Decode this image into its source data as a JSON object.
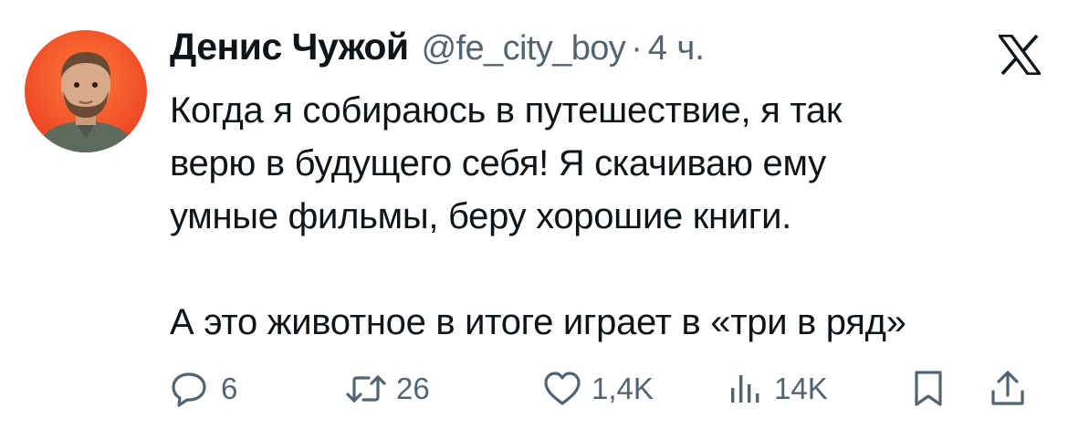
{
  "author": {
    "display_name": "Денис Чужой",
    "handle": "@fe_city_boy",
    "separator": "·",
    "time": "4 ч."
  },
  "tweet": {
    "text": "Когда я собираюсь в путешествие, я так\nверю в будущего себя! Я скачиваю ему\nумные фильмы, беру хорошие книги.\n\nА это животное в итоге играет в «три в ряд»"
  },
  "actions": {
    "replies": "6",
    "retweets": "26",
    "likes": "1,4K",
    "views": "14K"
  },
  "icons": {
    "platform": "x-logo-icon",
    "reply": "reply-icon",
    "retweet": "retweet-icon",
    "like": "heart-icon",
    "views": "views-icon",
    "bookmark": "bookmark-icon",
    "share": "share-icon"
  },
  "colors": {
    "text": "#0f1419",
    "secondary": "#536471",
    "avatar_bg": "#f2542d"
  }
}
